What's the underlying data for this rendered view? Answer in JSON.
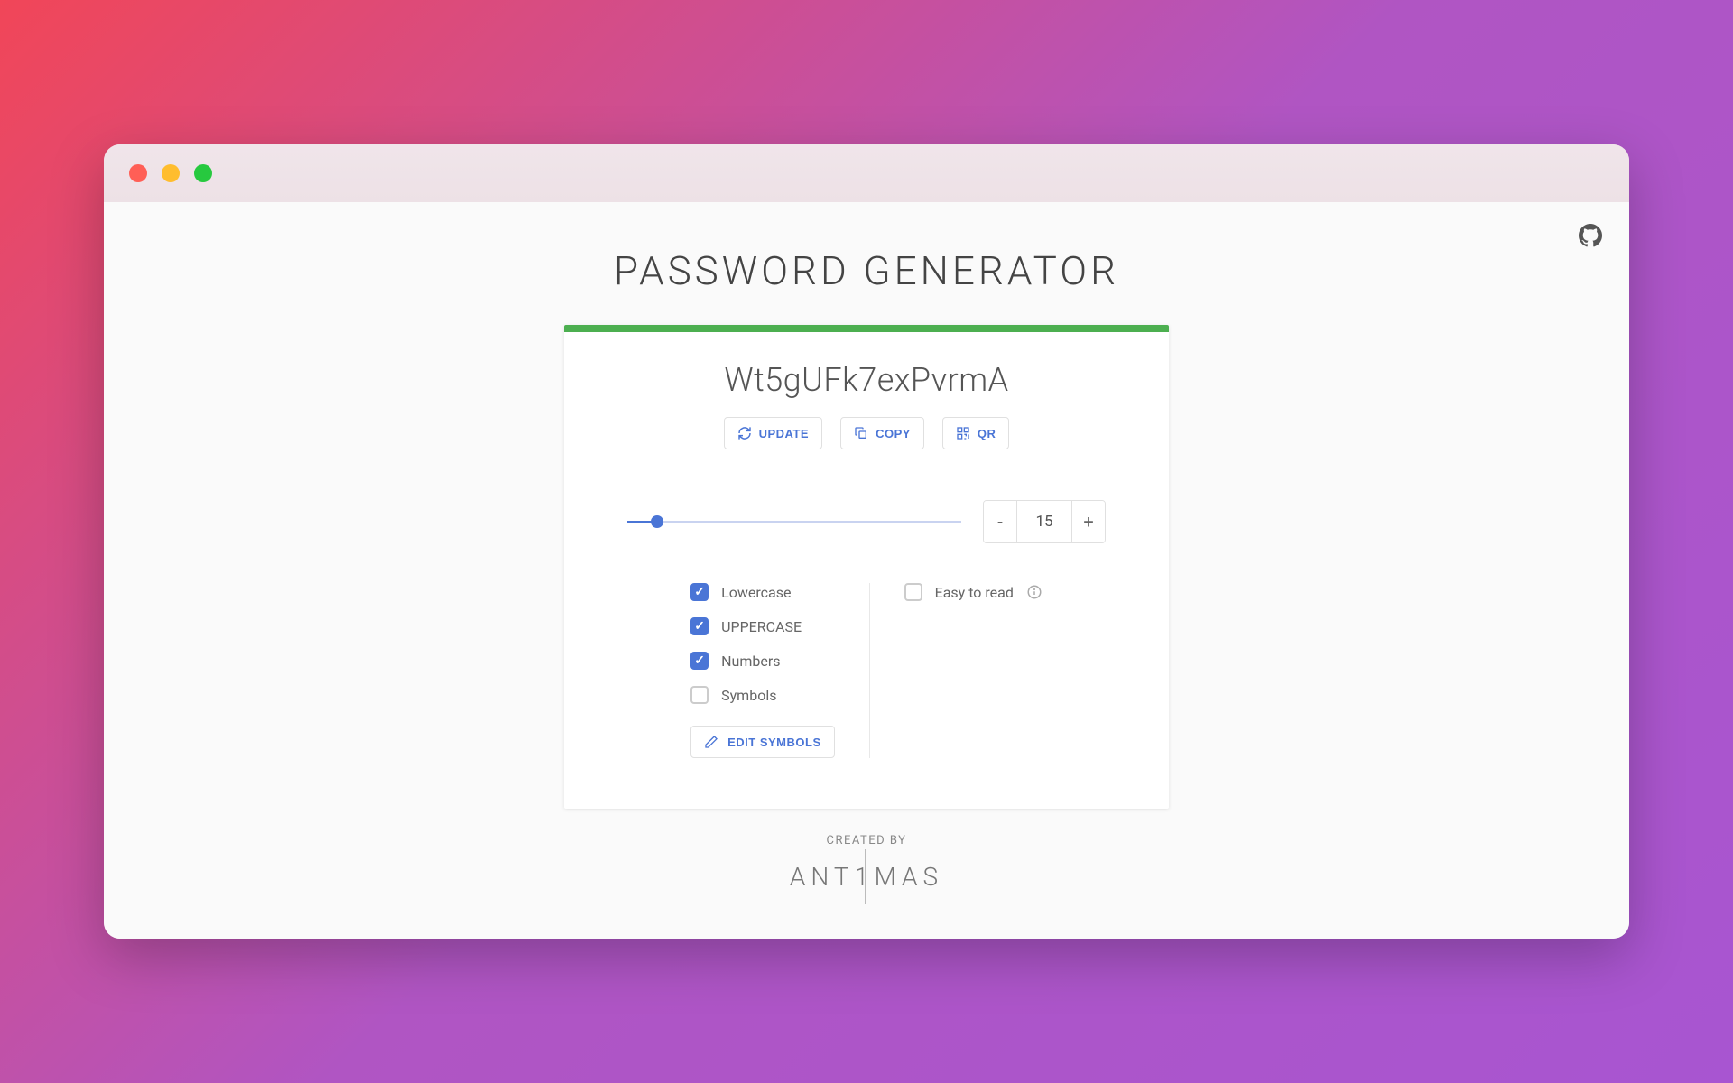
{
  "header": {
    "title": "PASSWORD GENERATOR"
  },
  "password": {
    "value": "Wt5gUFk7exPvrmA",
    "strength_color": "#4caf50"
  },
  "buttons": {
    "update": "UPDATE",
    "copy": "COPY",
    "qr": "QR",
    "edit_symbols": "EDIT SYMBOLS"
  },
  "length": {
    "value": "15",
    "min": 4,
    "max": 128,
    "decrement": "-",
    "increment": "+"
  },
  "options": {
    "lowercase": {
      "label": "Lowercase",
      "checked": true
    },
    "uppercase": {
      "label": "UPPERCASE",
      "checked": true
    },
    "numbers": {
      "label": "Numbers",
      "checked": true
    },
    "symbols": {
      "label": "Symbols",
      "checked": false
    },
    "easy_to_read": {
      "label": "Easy to read",
      "checked": false
    }
  },
  "footer": {
    "created_by": "CREATED BY",
    "logo_left": "ANT",
    "logo_mid": "1",
    "logo_right": "MAS"
  }
}
